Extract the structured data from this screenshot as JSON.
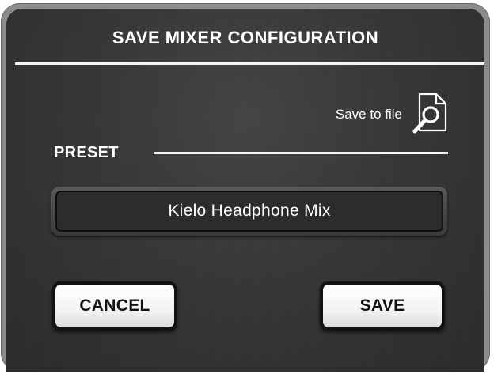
{
  "dialog": {
    "title": "SAVE MIXER CONFIGURATION",
    "save_to_file": {
      "label": "Save to file",
      "icon": "file-search-icon"
    },
    "preset": {
      "label": "PRESET",
      "value": "Kielo Headphone Mix"
    },
    "buttons": {
      "cancel_label": "CANCEL",
      "save_label": "SAVE"
    }
  },
  "colors": {
    "background": "#363636",
    "text": "#ffffff",
    "button_face": "#f3f3f3",
    "button_text": "#111111"
  }
}
